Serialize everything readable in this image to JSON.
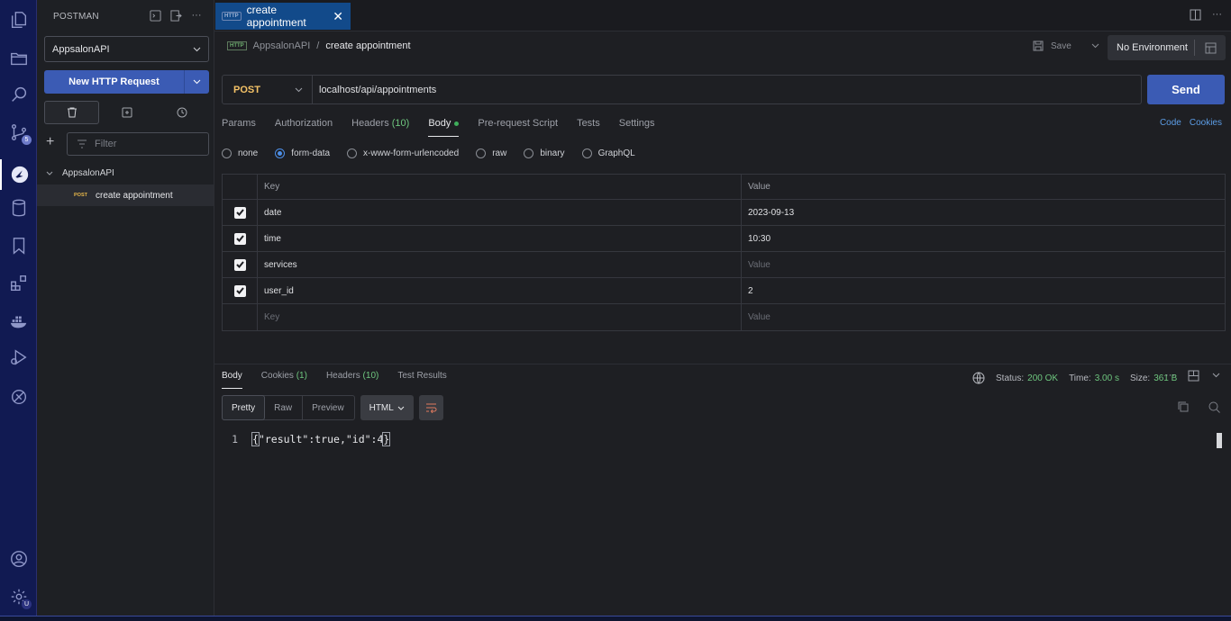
{
  "activity_bar": {
    "items": [
      {
        "name": "explorer-icon"
      },
      {
        "name": "folder-icon"
      },
      {
        "name": "search-icon"
      },
      {
        "name": "source-control-icon",
        "badge": "5"
      },
      {
        "name": "postman-icon",
        "active": true
      },
      {
        "name": "database-icon"
      },
      {
        "name": "bookmark-icon"
      },
      {
        "name": "extensions-icon"
      },
      {
        "name": "docker-icon"
      },
      {
        "name": "run-debug-icon"
      },
      {
        "name": "remote-icon"
      }
    ],
    "bottom": [
      {
        "name": "account-icon"
      },
      {
        "name": "settings-icon",
        "badge": "U"
      }
    ]
  },
  "sidebar": {
    "title": "POSTMAN",
    "workspace": "AppsalonAPI",
    "new_request_label": "New HTTP Request",
    "filter_placeholder": "Filter",
    "collection_name": "AppsalonAPI",
    "request": {
      "method": "POST",
      "name": "create appointment"
    }
  },
  "tab": {
    "badge": "HTTP",
    "title": "create appointment",
    "close": "✕"
  },
  "breadcrumb": {
    "badge": "HTTP",
    "workspace": "AppsalonAPI",
    "separator": "/",
    "current": "create appointment"
  },
  "toolbar": {
    "save_label": "Save",
    "environment": "No Environment"
  },
  "request": {
    "method": "POST",
    "url": "localhost/api/appointments",
    "send_label": "Send"
  },
  "request_tabs": [
    {
      "label": "Params"
    },
    {
      "label": "Authorization"
    },
    {
      "label": "Headers",
      "count": "(10)"
    },
    {
      "label": "Body",
      "active": true
    },
    {
      "label": "Pre-request Script"
    },
    {
      "label": "Tests"
    },
    {
      "label": "Settings"
    }
  ],
  "links": {
    "code": "Code",
    "cookies": "Cookies"
  },
  "body_types": [
    {
      "label": "none",
      "selected": false
    },
    {
      "label": "form-data",
      "selected": true
    },
    {
      "label": "x-www-form-urlencoded",
      "selected": false
    },
    {
      "label": "raw",
      "selected": false
    },
    {
      "label": "binary",
      "selected": false
    },
    {
      "label": "GraphQL",
      "selected": false
    }
  ],
  "form_table": {
    "headers": {
      "key": "Key",
      "value": "Value"
    },
    "rows": [
      {
        "checked": true,
        "key": "date",
        "value": "2023-09-13"
      },
      {
        "checked": true,
        "key": "time",
        "value": "10:30"
      },
      {
        "checked": true,
        "key": "services",
        "value": "",
        "value_placeholder": "Value"
      },
      {
        "checked": true,
        "key": "user_id",
        "value": "2"
      }
    ],
    "new_row": {
      "key_placeholder": "Key",
      "value_placeholder": "Value"
    }
  },
  "response_tabs": [
    {
      "label": "Body",
      "active": true
    },
    {
      "label": "Cookies",
      "count": "(1)"
    },
    {
      "label": "Headers",
      "count": "(10)"
    },
    {
      "label": "Test Results"
    }
  ],
  "response_status": {
    "status_label": "Status:",
    "status": "200 OK",
    "time_label": "Time:",
    "time": "3.00 s",
    "size_label": "Size:",
    "size": "361 B"
  },
  "view_modes": [
    {
      "label": "Pretty",
      "active": true
    },
    {
      "label": "Raw"
    },
    {
      "label": "Preview"
    }
  ],
  "format": "HTML",
  "response_body": {
    "line_number": "1",
    "open": "{",
    "text": "\"result\":true,\"id\":4",
    "close": "}"
  },
  "colors": {
    "activity_bar": "#111a52",
    "accent_blue": "#3b5bb4",
    "tab_active": "#124a8a",
    "post_method": "#f4c267",
    "status_ok": "#6ec67e"
  }
}
